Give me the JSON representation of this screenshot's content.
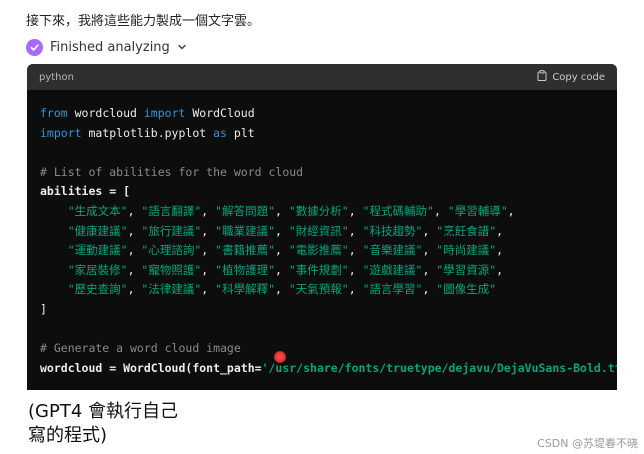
{
  "intro_text": "接下來，我將這些能力製成一個文字雲。",
  "status": {
    "label": "Finished analyzing",
    "icon": "check-circle-icon",
    "accent": "#ab68ff"
  },
  "code": {
    "language": "python",
    "copy_label": "Copy code",
    "lines": [
      [
        {
          "t": "from",
          "c": "kw"
        },
        {
          "t": " wordcloud ",
          "c": "plain"
        },
        {
          "t": "import",
          "c": "kw"
        },
        {
          "t": " WordCloud",
          "c": "plain"
        }
      ],
      [
        {
          "t": "import",
          "c": "kw"
        },
        {
          "t": " matplotlib.pyplot ",
          "c": "plain"
        },
        {
          "t": "as",
          "c": "kw"
        },
        {
          "t": " plt",
          "c": "plain"
        }
      ],
      [],
      [
        {
          "t": "# List of abilities for the word cloud",
          "c": "cmt"
        }
      ],
      [
        {
          "t": "abilities = [",
          "c": "plain"
        }
      ],
      [
        {
          "t": "    ",
          "c": "plain"
        },
        {
          "t": "\"生成文本\"",
          "c": "str"
        },
        {
          "t": ", ",
          "c": "plain"
        },
        {
          "t": "\"語言翻譯\"",
          "c": "str"
        },
        {
          "t": ", ",
          "c": "plain"
        },
        {
          "t": "\"解答問題\"",
          "c": "str"
        },
        {
          "t": ", ",
          "c": "plain"
        },
        {
          "t": "\"數據分析\"",
          "c": "str"
        },
        {
          "t": ", ",
          "c": "plain"
        },
        {
          "t": "\"程式碼輔助\"",
          "c": "str"
        },
        {
          "t": ", ",
          "c": "plain"
        },
        {
          "t": "\"學習輔導\"",
          "c": "str"
        },
        {
          "t": ",",
          "c": "plain"
        }
      ],
      [
        {
          "t": "    ",
          "c": "plain"
        },
        {
          "t": "\"健康建議\"",
          "c": "str"
        },
        {
          "t": ", ",
          "c": "plain"
        },
        {
          "t": "\"旅行建議\"",
          "c": "str"
        },
        {
          "t": ", ",
          "c": "plain"
        },
        {
          "t": "\"職業建議\"",
          "c": "str"
        },
        {
          "t": ", ",
          "c": "plain"
        },
        {
          "t": "\"財經資訊\"",
          "c": "str"
        },
        {
          "t": ", ",
          "c": "plain"
        },
        {
          "t": "\"科技趨勢\"",
          "c": "str"
        },
        {
          "t": ", ",
          "c": "plain"
        },
        {
          "t": "\"烹飪食譜\"",
          "c": "str"
        },
        {
          "t": ",",
          "c": "plain"
        }
      ],
      [
        {
          "t": "    ",
          "c": "plain"
        },
        {
          "t": "\"運動建議\"",
          "c": "str"
        },
        {
          "t": ", ",
          "c": "plain"
        },
        {
          "t": "\"心理諮詢\"",
          "c": "str"
        },
        {
          "t": ", ",
          "c": "plain"
        },
        {
          "t": "\"書籍推薦\"",
          "c": "str"
        },
        {
          "t": ", ",
          "c": "plain"
        },
        {
          "t": "\"電影推薦\"",
          "c": "str"
        },
        {
          "t": ", ",
          "c": "plain"
        },
        {
          "t": "\"音樂建議\"",
          "c": "str"
        },
        {
          "t": ", ",
          "c": "plain"
        },
        {
          "t": "\"時尚建議\"",
          "c": "str"
        },
        {
          "t": ",",
          "c": "plain"
        }
      ],
      [
        {
          "t": "    ",
          "c": "plain"
        },
        {
          "t": "\"家居裝修\"",
          "c": "str"
        },
        {
          "t": ", ",
          "c": "plain"
        },
        {
          "t": "\"寵物照護\"",
          "c": "str"
        },
        {
          "t": ", ",
          "c": "plain"
        },
        {
          "t": "\"植物護理\"",
          "c": "str"
        },
        {
          "t": ", ",
          "c": "plain"
        },
        {
          "t": "\"事件規劃\"",
          "c": "str"
        },
        {
          "t": ", ",
          "c": "plain"
        },
        {
          "t": "\"遊戲建議\"",
          "c": "str"
        },
        {
          "t": ", ",
          "c": "plain"
        },
        {
          "t": "\"學習資源\"",
          "c": "str"
        },
        {
          "t": ",",
          "c": "plain"
        }
      ],
      [
        {
          "t": "    ",
          "c": "plain"
        },
        {
          "t": "\"歷史查詢\"",
          "c": "str"
        },
        {
          "t": ", ",
          "c": "plain"
        },
        {
          "t": "\"法律建議\"",
          "c": "str"
        },
        {
          "t": ", ",
          "c": "plain"
        },
        {
          "t": "\"科學解釋\"",
          "c": "str"
        },
        {
          "t": ", ",
          "c": "plain"
        },
        {
          "t": "\"天氣預報\"",
          "c": "str"
        },
        {
          "t": ", ",
          "c": "plain"
        },
        {
          "t": "\"語言學習\"",
          "c": "str"
        },
        {
          "t": ", ",
          "c": "plain"
        },
        {
          "t": "\"圖像生成\"",
          "c": "str"
        }
      ],
      [
        {
          "t": "]",
          "c": "plain"
        }
      ],
      [],
      [
        {
          "t": "# Generate a word cloud image",
          "c": "cmt"
        }
      ],
      [
        {
          "t": "wordcloud = WordCloud(font_path=",
          "c": "plain"
        },
        {
          "t": "'/usr/share/fonts/truetype/dejavu/DejaVuSans-Bold.ttf'",
          "c": "str"
        }
      ]
    ]
  },
  "caption_lines": [
    "(GPT4 會執行自己",
    "寫的程式)"
  ],
  "watermark": "CSDN @苏堤春不晓"
}
